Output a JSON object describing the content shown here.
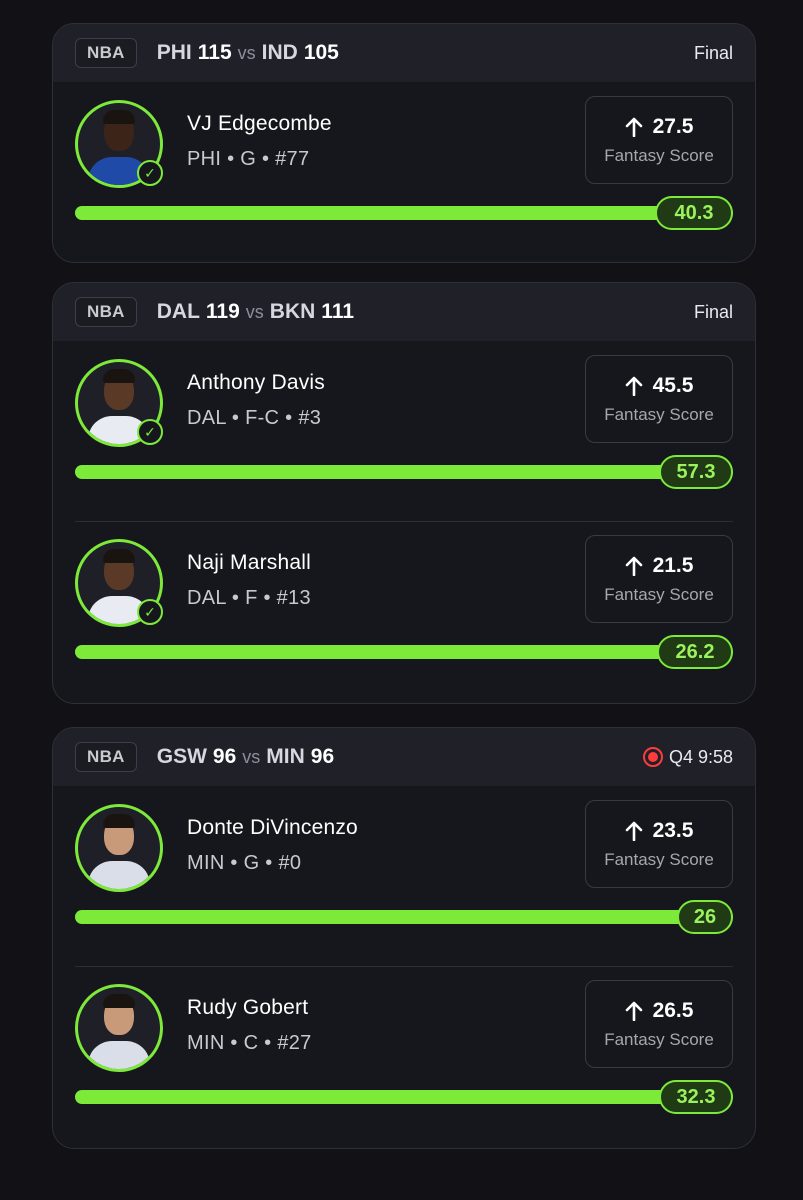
{
  "games": [
    {
      "league": "NBA",
      "home_team": "PHI",
      "home_score": "115",
      "vs": "vs",
      "away_team": "IND",
      "away_score": "105",
      "status": "Final",
      "live": false,
      "players": [
        {
          "name": "VJ Edgecombe",
          "meta": "PHI • G • #77",
          "line": "27.5",
          "label": "Fantasy Score",
          "actual": "40.3",
          "progress": 1.0,
          "checked": true,
          "team_style": "phi"
        }
      ]
    },
    {
      "league": "NBA",
      "home_team": "DAL",
      "home_score": "119",
      "vs": "vs",
      "away_team": "BKN",
      "away_score": "111",
      "status": "Final",
      "live": false,
      "players": [
        {
          "name": "Anthony Davis",
          "meta": "DAL • F-C • #3",
          "line": "45.5",
          "label": "Fantasy Score",
          "actual": "57.3",
          "progress": 1.0,
          "checked": true,
          "team_style": "dal"
        },
        {
          "name": "Naji Marshall",
          "meta": "DAL • F • #13",
          "line": "21.5",
          "label": "Fantasy Score",
          "actual": "26.2",
          "progress": 1.0,
          "checked": true,
          "team_style": "dal"
        }
      ]
    },
    {
      "league": "NBA",
      "home_team": "GSW",
      "home_score": "96",
      "vs": "vs",
      "away_team": "MIN",
      "away_score": "96",
      "status": "Q4 9:58",
      "live": true,
      "players": [
        {
          "name": "Donte DiVincenzo",
          "meta": "MIN • G • #0",
          "line": "23.5",
          "label": "Fantasy Score",
          "actual": "26",
          "progress": 1.0,
          "checked": false,
          "team_style": "min"
        },
        {
          "name": "Rudy Gobert",
          "meta": "MIN • C • #27",
          "line": "26.5",
          "label": "Fantasy Score",
          "actual": "32.3",
          "progress": 1.0,
          "checked": false,
          "team_style": "min"
        }
      ]
    }
  ],
  "colors": {
    "accent_green": "#7dea3a",
    "live_red": "#ff3b3b",
    "card_bg": "#16161d",
    "header_bg": "#202029"
  },
  "icons": {
    "arrow": "arrow-up-icon",
    "check": "check-circle-icon",
    "live": "live-record-icon"
  }
}
